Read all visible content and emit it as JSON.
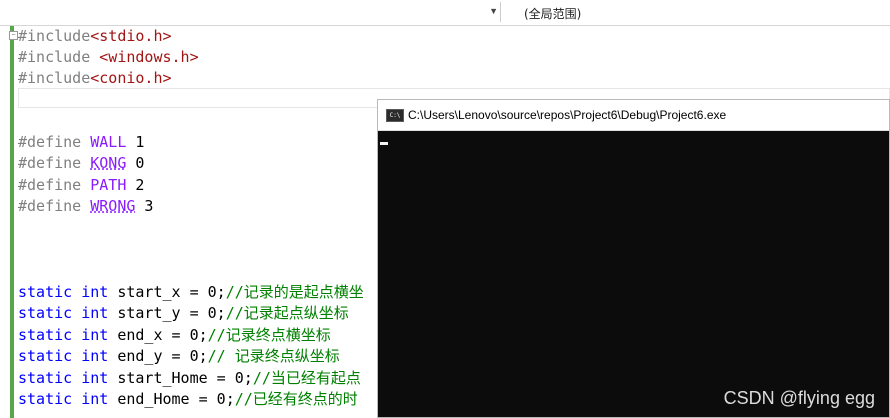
{
  "topbar": {
    "left_selector_value": "",
    "right_selector_label": "(全局范围)"
  },
  "code": {
    "line1_directive": "#include",
    "line1_header": "<stdio.h>",
    "line2_directive": "#include ",
    "line2_header": "<windows.h>",
    "line3_directive": "#include",
    "line3_header": "<conio.h>",
    "define1_kw": "#define ",
    "define1_name": "WALL",
    "define1_val": " 1",
    "define2_kw": "#define ",
    "define2_name": "KONG",
    "define2_val": " 0",
    "define3_kw": "#define ",
    "define3_name": "PATH",
    "define3_val": " 2",
    "define4_kw": "#define ",
    "define4_name": "WRONG",
    "define4_val": " 3",
    "s1_code": " start_x = 0;",
    "s1_comment": "//记录的是起点横坐",
    "s2_code": " start_y = 0;",
    "s2_comment": "//记录起点纵坐标",
    "s3_code": " end_x = 0;",
    "s3_comment": "//记录终点横坐标",
    "s4_code": " end_y = 0;",
    "s4_comment": "// 记录终点纵坐标",
    "s5_code": " start_Home = 0;",
    "s5_comment": "//当已经有起点",
    "s6_code": " end_Home = 0;",
    "s6_comment": "//已经有终点的时",
    "kw_static": "static",
    "kw_int": " int"
  },
  "console": {
    "icon_text": "C:\\",
    "title": "C:\\Users\\Lenovo\\source\\repos\\Project6\\Debug\\Project6.exe"
  },
  "watermark": "CSDN @flying egg",
  "colors": {
    "preprocessor": "#808080",
    "include_string": "#a31515",
    "macro": "#8a1bff",
    "keyword": "#0000ff",
    "comment": "#008000",
    "console_bg": "#0c0c0c"
  }
}
